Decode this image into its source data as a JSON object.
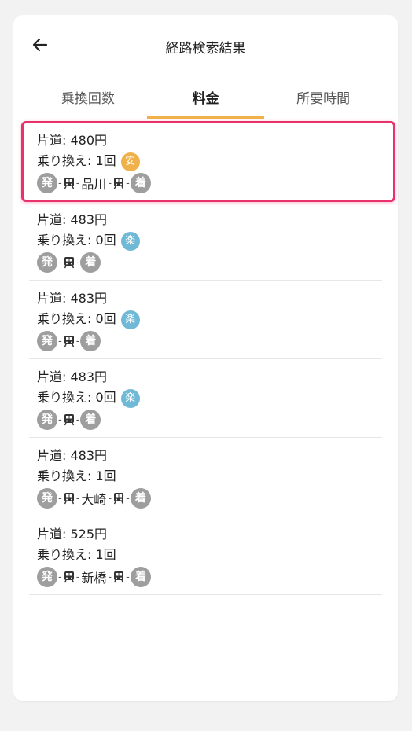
{
  "header": {
    "title": "経路検索結果"
  },
  "tabs": [
    {
      "label": "乗換回数",
      "active": false
    },
    {
      "label": "料金",
      "active": true
    },
    {
      "label": "所要時間",
      "active": false
    }
  ],
  "colors": {
    "accent_tab": "#f0b14a",
    "selected_border": "#e8326c",
    "badge_cheap": "#f0b14a",
    "badge_easy": "#6fb8d6",
    "stop_circle": "#9e9e9e"
  },
  "routes": [
    {
      "fare": "片道: 480円",
      "transfers": "乗り換え: 1回",
      "badge": "安",
      "badge_type": "cheap",
      "start": "発",
      "via": "品川",
      "end": "着",
      "selected": true
    },
    {
      "fare": "片道: 483円",
      "transfers": "乗り換え: 0回",
      "badge": "楽",
      "badge_type": "easy",
      "start": "発",
      "via": "",
      "end": "着",
      "selected": false
    },
    {
      "fare": "片道: 483円",
      "transfers": "乗り換え: 0回",
      "badge": "楽",
      "badge_type": "easy",
      "start": "発",
      "via": "",
      "end": "着",
      "selected": false
    },
    {
      "fare": "片道: 483円",
      "transfers": "乗り換え: 0回",
      "badge": "楽",
      "badge_type": "easy",
      "start": "発",
      "via": "",
      "end": "着",
      "selected": false
    },
    {
      "fare": "片道: 483円",
      "transfers": "乗り換え: 1回",
      "badge": "",
      "badge_type": "",
      "start": "発",
      "via": "大崎",
      "end": "着",
      "selected": false
    },
    {
      "fare": "片道: 525円",
      "transfers": "乗り換え: 1回",
      "badge": "",
      "badge_type": "",
      "start": "発",
      "via": "新橋",
      "end": "着",
      "selected": false
    }
  ],
  "icons": {
    "back": "arrow-left-icon",
    "train": "train-icon"
  }
}
